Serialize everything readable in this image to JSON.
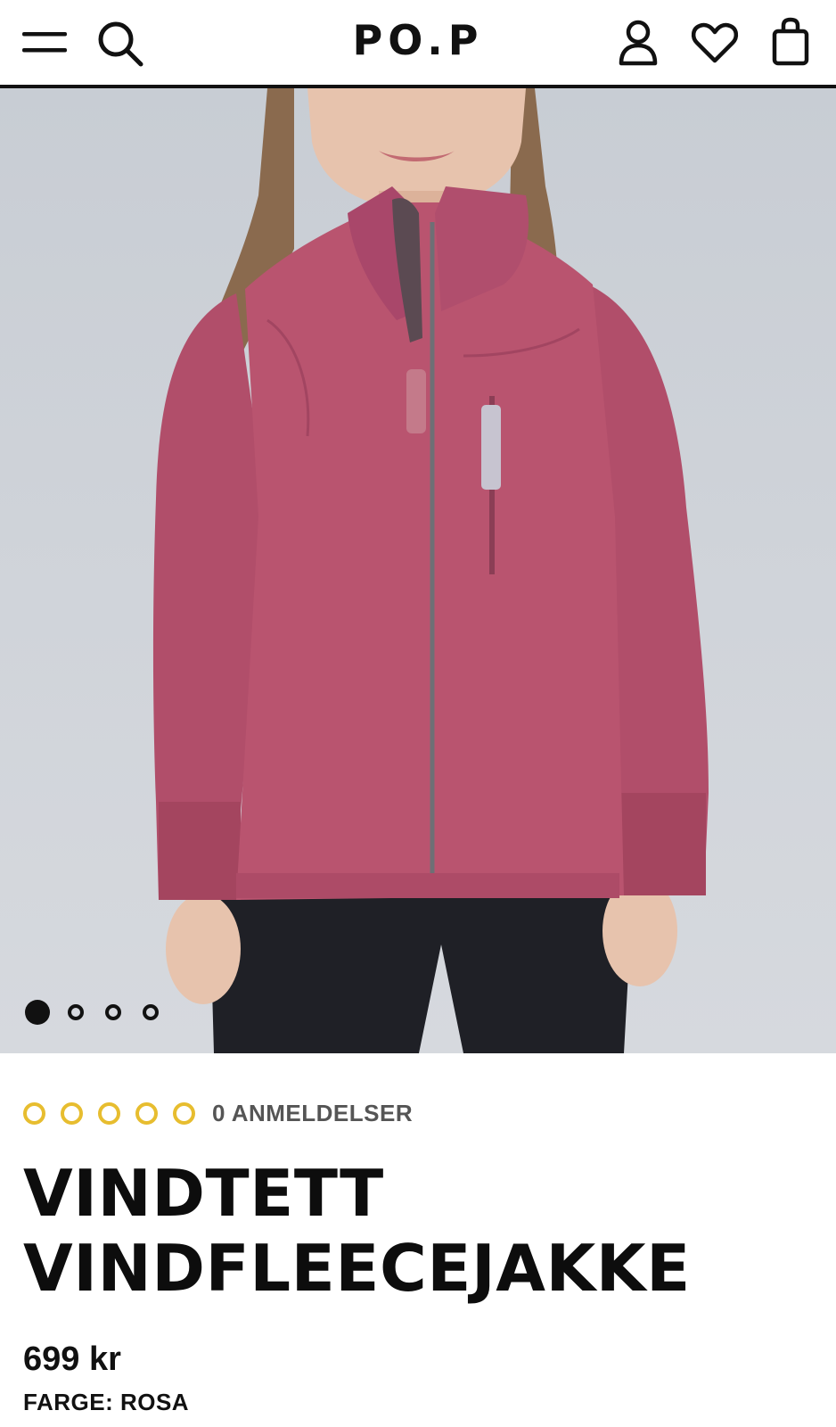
{
  "header": {
    "logo": "PO.P",
    "menu_icon": "hamburger-menu-icon",
    "search_icon": "search-icon",
    "account_icon": "user-icon",
    "wishlist_icon": "heart-icon",
    "cart_icon": "shopping-bag-icon"
  },
  "gallery": {
    "image_alt": "Girl wearing pink fleece jacket",
    "slide_count": 4,
    "active_slide": 1
  },
  "product": {
    "rating_stars": 5,
    "rating_value": 0,
    "review_count_label": "0 ANMELDELSER",
    "title": "VINDTETT VINDFLEECEJAKKE",
    "price": "699 kr",
    "color_label": "FARGE: ROSA"
  },
  "colors": {
    "accent_star": "#e7bd2f",
    "jacket": "#b5526e",
    "background": "#cfd3d9"
  }
}
